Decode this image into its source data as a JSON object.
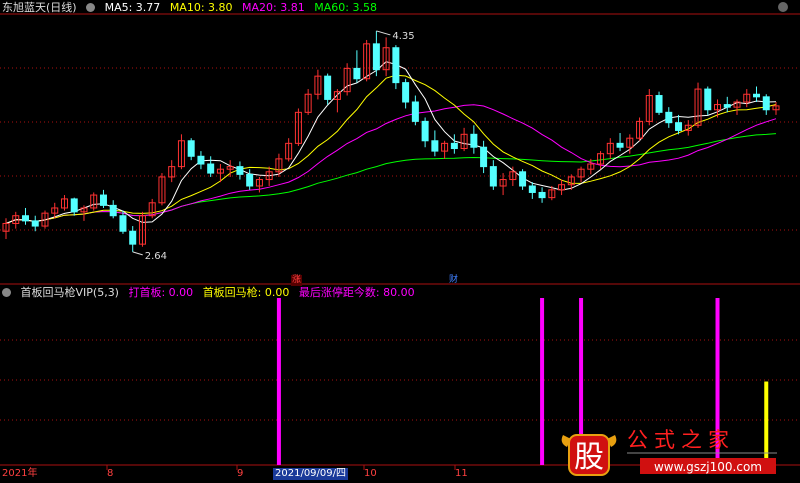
{
  "header": {
    "stock_name": "东旭蓝天(日线)",
    "ma5": "MA5: 3.77",
    "ma10": "MA10: 3.80",
    "ma20": "MA20: 3.81",
    "ma60": "MA60: 3.58"
  },
  "indicator_header": {
    "name": "首板回马枪VIP(5,3)",
    "da_shou_ban": "打首板: 0.00",
    "shou_ban_hui_ma_qiang": "首板回马枪: 0.00",
    "zui_hou_zhang_ting": "最后涨停距今数: 80.00"
  },
  "markers": {
    "zhang": "涨",
    "cai": "财",
    "high_price": "4.35",
    "low_price": "2.64"
  },
  "x_axis": {
    "year": "2021年",
    "m8": "8",
    "m9": "9",
    "date_cursor": "2021/09/09/四",
    "m10": "10",
    "m11": "11"
  },
  "watermark": {
    "logo_char": "股",
    "brand": "公式之家",
    "url": "www.gszj100.com"
  },
  "colors": {
    "up": "#ff3232",
    "down": "#54ffff",
    "ma5": "#ffffff",
    "ma10": "#ffff00",
    "ma20": "#ff00ff",
    "ma60": "#00ff00",
    "bar_magenta": "#ff00ff",
    "bar_yellow": "#ffff00"
  },
  "chart_data": {
    "type": "candlestick",
    "ylim": [
      2.5,
      4.45
    ],
    "candles": [
      [
        2.8,
        2.9,
        2.74,
        2.86
      ],
      [
        2.86,
        2.95,
        2.82,
        2.92
      ],
      [
        2.92,
        2.98,
        2.85,
        2.88
      ],
      [
        2.88,
        2.92,
        2.8,
        2.84
      ],
      [
        2.84,
        2.96,
        2.82,
        2.94
      ],
      [
        2.94,
        3.02,
        2.9,
        2.98
      ],
      [
        2.98,
        3.08,
        2.96,
        3.05
      ],
      [
        3.05,
        3.06,
        2.92,
        2.95
      ],
      [
        2.95,
        3.0,
        2.88,
        2.98
      ],
      [
        2.98,
        3.1,
        2.96,
        3.08
      ],
      [
        3.08,
        3.12,
        2.98,
        3.0
      ],
      [
        3.0,
        3.04,
        2.9,
        2.92
      ],
      [
        2.92,
        2.96,
        2.78,
        2.8
      ],
      [
        2.8,
        2.84,
        2.64,
        2.7
      ],
      [
        2.7,
        2.95,
        2.68,
        2.92
      ],
      [
        2.92,
        3.05,
        2.9,
        3.02
      ],
      [
        3.02,
        3.25,
        3.0,
        3.22
      ],
      [
        3.22,
        3.35,
        3.18,
        3.3
      ],
      [
        3.3,
        3.55,
        3.28,
        3.5
      ],
      [
        3.5,
        3.52,
        3.35,
        3.38
      ],
      [
        3.38,
        3.42,
        3.28,
        3.32
      ],
      [
        3.32,
        3.38,
        3.22,
        3.25
      ],
      [
        3.25,
        3.32,
        3.18,
        3.28
      ],
      [
        3.28,
        3.35,
        3.22,
        3.3
      ],
      [
        3.3,
        3.34,
        3.2,
        3.24
      ],
      [
        3.24,
        3.28,
        3.12,
        3.15
      ],
      [
        3.15,
        3.22,
        3.1,
        3.2
      ],
      [
        3.2,
        3.3,
        3.15,
        3.26
      ],
      [
        3.26,
        3.4,
        3.22,
        3.36
      ],
      [
        3.36,
        3.52,
        3.34,
        3.48
      ],
      [
        3.48,
        3.75,
        3.46,
        3.72
      ],
      [
        3.72,
        3.9,
        3.7,
        3.86
      ],
      [
        3.86,
        4.05,
        3.82,
        4.0
      ],
      [
        4.0,
        4.02,
        3.78,
        3.82
      ],
      [
        3.82,
        3.9,
        3.72,
        3.88
      ],
      [
        3.88,
        4.1,
        3.85,
        4.06
      ],
      [
        4.06,
        4.2,
        3.95,
        3.98
      ],
      [
        3.98,
        4.28,
        3.96,
        4.25
      ],
      [
        4.25,
        4.35,
        4.0,
        4.05
      ],
      [
        4.05,
        4.3,
        4.0,
        4.22
      ],
      [
        4.22,
        4.24,
        3.9,
        3.95
      ],
      [
        3.95,
        3.98,
        3.75,
        3.8
      ],
      [
        3.8,
        3.85,
        3.62,
        3.65
      ],
      [
        3.65,
        3.68,
        3.45,
        3.5
      ],
      [
        3.5,
        3.58,
        3.38,
        3.42
      ],
      [
        3.42,
        3.5,
        3.36,
        3.48
      ],
      [
        3.48,
        3.55,
        3.4,
        3.44
      ],
      [
        3.44,
        3.6,
        3.42,
        3.55
      ],
      [
        3.55,
        3.62,
        3.4,
        3.45
      ],
      [
        3.45,
        3.5,
        3.25,
        3.3
      ],
      [
        3.3,
        3.35,
        3.12,
        3.15
      ],
      [
        3.15,
        3.25,
        3.08,
        3.2
      ],
      [
        3.2,
        3.3,
        3.15,
        3.26
      ],
      [
        3.26,
        3.28,
        3.12,
        3.15
      ],
      [
        3.15,
        3.18,
        3.05,
        3.1
      ],
      [
        3.1,
        3.14,
        3.02,
        3.06
      ],
      [
        3.06,
        3.15,
        3.04,
        3.12
      ],
      [
        3.12,
        3.2,
        3.08,
        3.16
      ],
      [
        3.16,
        3.24,
        3.12,
        3.22
      ],
      [
        3.22,
        3.3,
        3.18,
        3.28
      ],
      [
        3.28,
        3.36,
        3.24,
        3.32
      ],
      [
        3.32,
        3.42,
        3.28,
        3.4
      ],
      [
        3.4,
        3.52,
        3.36,
        3.48
      ],
      [
        3.48,
        3.56,
        3.42,
        3.45
      ],
      [
        3.45,
        3.55,
        3.4,
        3.52
      ],
      [
        3.52,
        3.68,
        3.5,
        3.65
      ],
      [
        3.65,
        3.9,
        3.62,
        3.85
      ],
      [
        3.85,
        3.88,
        3.7,
        3.72
      ],
      [
        3.72,
        3.76,
        3.6,
        3.64
      ],
      [
        3.64,
        3.7,
        3.55,
        3.58
      ],
      [
        3.58,
        3.66,
        3.54,
        3.62
      ],
      [
        3.62,
        3.95,
        3.6,
        3.9
      ],
      [
        3.9,
        3.92,
        3.7,
        3.74
      ],
      [
        3.74,
        3.82,
        3.68,
        3.78
      ],
      [
        3.78,
        3.84,
        3.72,
        3.76
      ],
      [
        3.76,
        3.82,
        3.7,
        3.8
      ],
      [
        3.8,
        3.9,
        3.76,
        3.86
      ],
      [
        3.86,
        3.92,
        3.8,
        3.84
      ],
      [
        3.84,
        3.86,
        3.7,
        3.74
      ],
      [
        3.74,
        3.8,
        3.7,
        3.77
      ]
    ],
    "ma_series": [
      "MA5",
      "MA10",
      "MA20",
      "MA60"
    ],
    "indicator_bars": [
      {
        "index": 28,
        "value": 1.0,
        "color": "magenta"
      },
      {
        "index": 55,
        "value": 1.0,
        "color": "magenta"
      },
      {
        "index": 59,
        "value": 1.0,
        "color": "magenta"
      },
      {
        "index": 73,
        "value": 1.0,
        "color": "magenta"
      },
      {
        "index": 78,
        "value": 0.5,
        "color": "yellow"
      }
    ]
  }
}
